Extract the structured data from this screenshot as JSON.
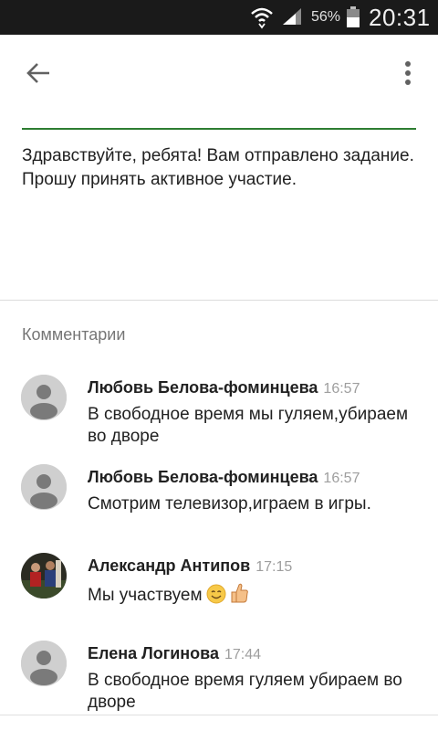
{
  "status_bar": {
    "battery_percent": "56%",
    "time": "20:31",
    "icons": [
      "wifi-icon",
      "signal-icon",
      "battery-icon"
    ]
  },
  "app_bar": {
    "icons": [
      "back-arrow-icon",
      "more-vert-icon"
    ]
  },
  "post": {
    "body": "Здравствуйте, ребята! Вам отправлено задание. Прошу принять активное участие."
  },
  "comments": {
    "heading": "Комментарии",
    "items": [
      {
        "author": "Любовь Белова-фоминцева",
        "time": "16:57",
        "text": "В свободное время мы гуляем,убираем во дворе",
        "avatar": "default-avatar-icon"
      },
      {
        "author": "Любовь Белова-фоминцева",
        "time": "16:57",
        "text": "Смотрим  телевизор,играем в игры.",
        "avatar": "default-avatar-icon"
      },
      {
        "author": "Александр Антипов",
        "time": "17:15",
        "text": "Мы участвуем",
        "avatar": "photo-avatar",
        "emojis": [
          "smiling-face-emoji",
          "thumbs-up-emoji"
        ]
      },
      {
        "author": "Елена Логинова",
        "time": "17:44",
        "text": "В свободное время гуляем убираем во дворе",
        "avatar": "default-avatar-icon"
      }
    ]
  },
  "colors": {
    "status_bar_bg": "#1a1a1a",
    "accent_line": "#2e7d32",
    "secondary_text": "#757575",
    "timestamp": "#9e9e9e"
  }
}
